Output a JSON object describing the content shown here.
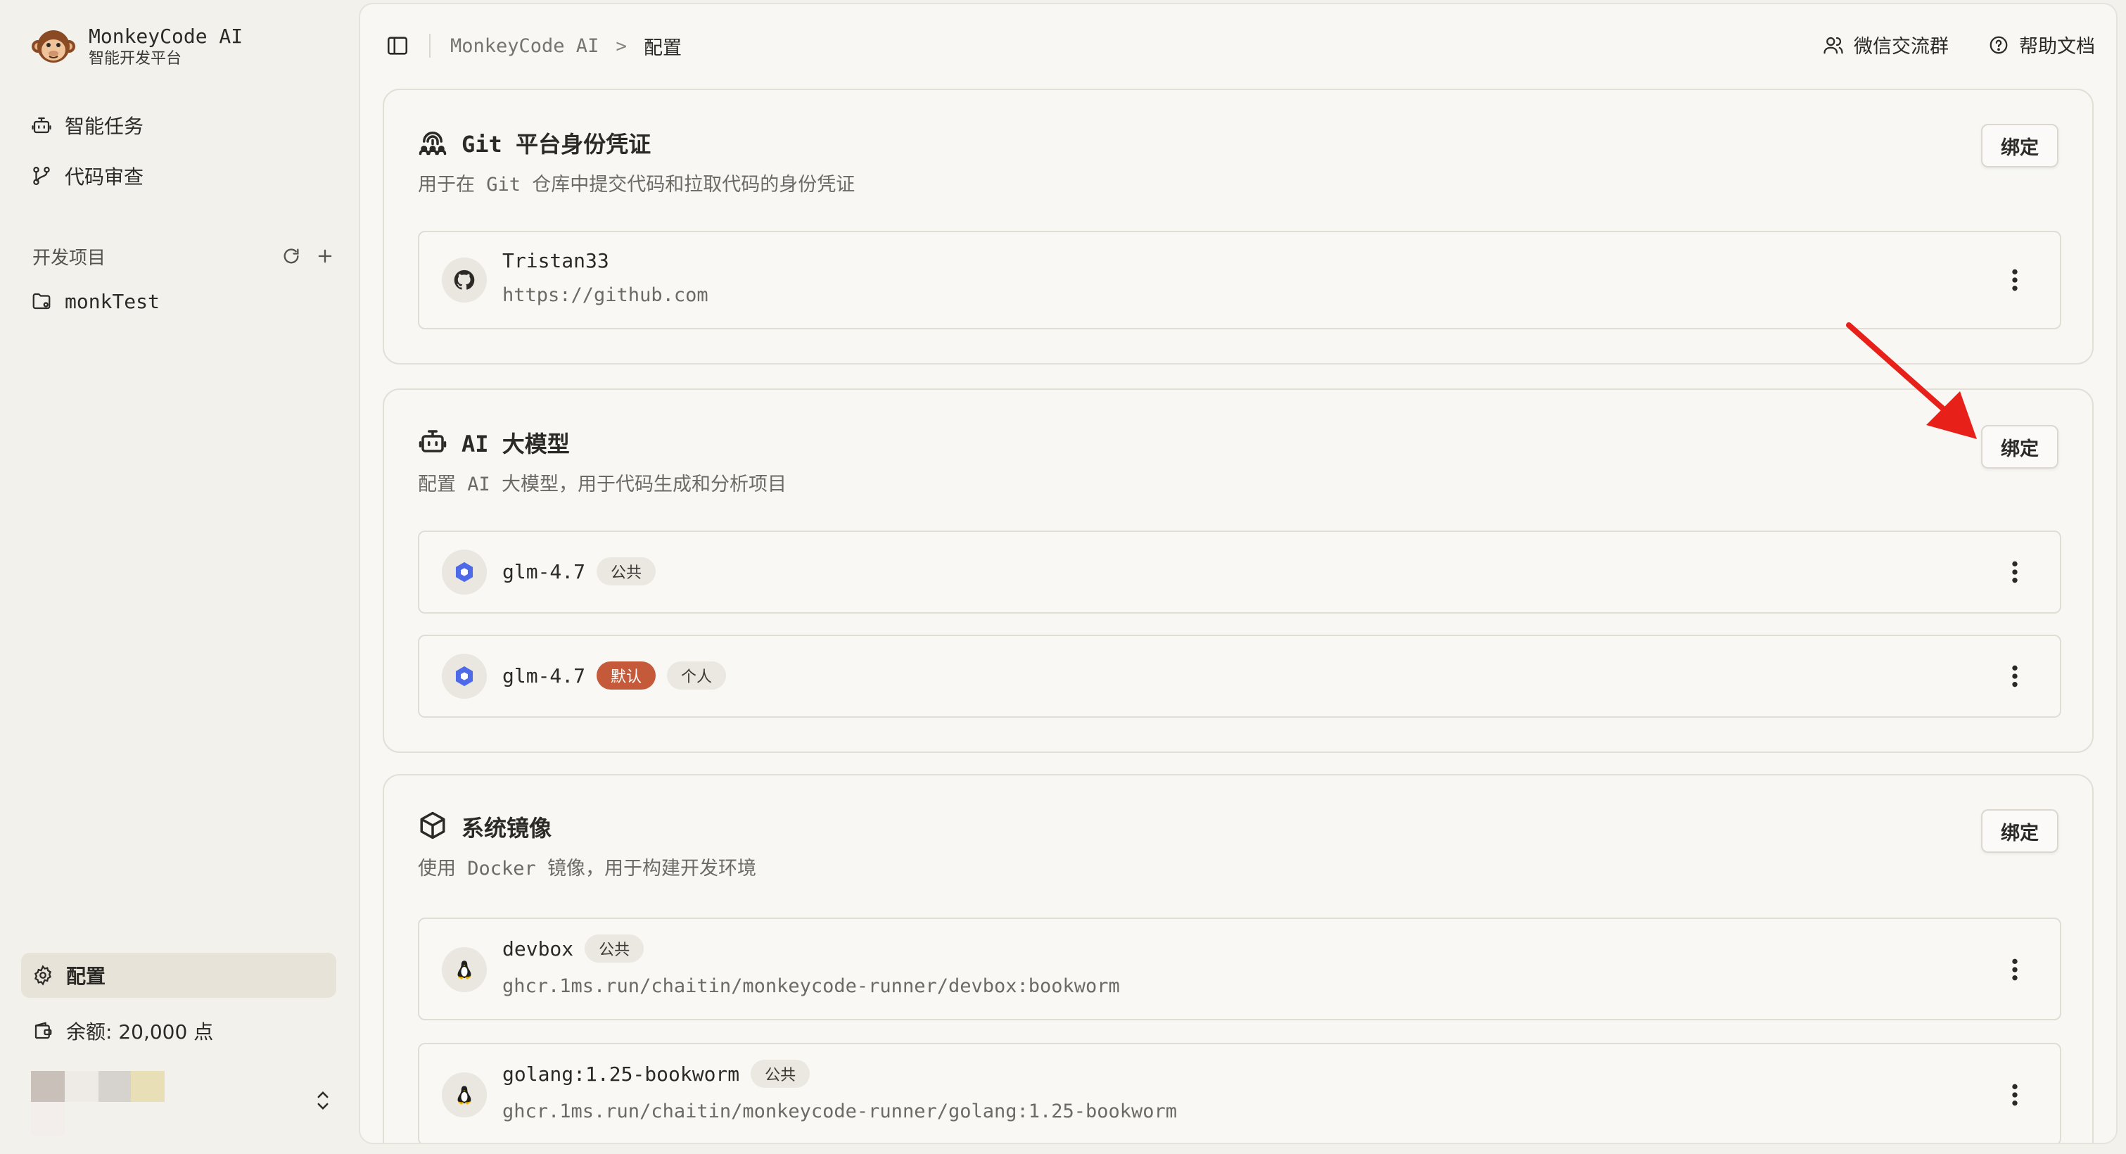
{
  "app": {
    "name": "MonkeyCode AI",
    "subtitle": "智能开发平台"
  },
  "sidebar": {
    "nav": [
      {
        "label": "智能任务",
        "icon": "robot-icon"
      },
      {
        "label": "代码审查",
        "icon": "merge-icon"
      }
    ],
    "projects_title": "开发项目",
    "projects": [
      {
        "label": "monkTest",
        "icon": "folder-icon"
      }
    ],
    "settings_label": "配置",
    "balance_label": "余额: 20,000 点"
  },
  "topbar": {
    "breadcrumb_root": "MonkeyCode AI",
    "breadcrumb_sep": ">",
    "breadcrumb_current": "配置",
    "wechat_label": "微信交流群",
    "help_label": "帮助文档"
  },
  "sections": {
    "git": {
      "title": "Git 平台身份凭证",
      "desc": "用于在 Git 仓库中提交代码和拉取代码的身份凭证",
      "bind_label": "绑定",
      "items": [
        {
          "name": "Tristan33",
          "url": "https://github.com",
          "icon": "github-icon"
        }
      ]
    },
    "ai": {
      "title": "AI 大模型",
      "desc": "配置 AI 大模型，用于代码生成和分析项目",
      "bind_label": "绑定",
      "items": [
        {
          "name": "glm-4.7",
          "tags": [
            "公共"
          ],
          "icon": "model-hex-icon"
        },
        {
          "name": "glm-4.7",
          "tags": [
            "默认",
            "个人"
          ],
          "icon": "model-hex-icon"
        }
      ]
    },
    "image": {
      "title": "系统镜像",
      "desc": "使用 Docker 镜像，用于构建开发环境",
      "bind_label": "绑定",
      "items": [
        {
          "name": "devbox",
          "tags": [
            "公共"
          ],
          "path": "ghcr.1ms.run/chaitin/monkeycode-runner/devbox:bookworm",
          "icon": "linux-icon"
        },
        {
          "name": "golang:1.25-bookworm",
          "tags": [
            "公共"
          ],
          "path": "ghcr.1ms.run/chaitin/monkeycode-runner/golang:1.25-bookworm",
          "icon": "linux-icon"
        }
      ]
    }
  },
  "colors": {
    "accent": "#c55a3a",
    "annotation_arrow": "#e8201a",
    "background": "#f3f1ec",
    "panel": "#f8f7f4"
  }
}
